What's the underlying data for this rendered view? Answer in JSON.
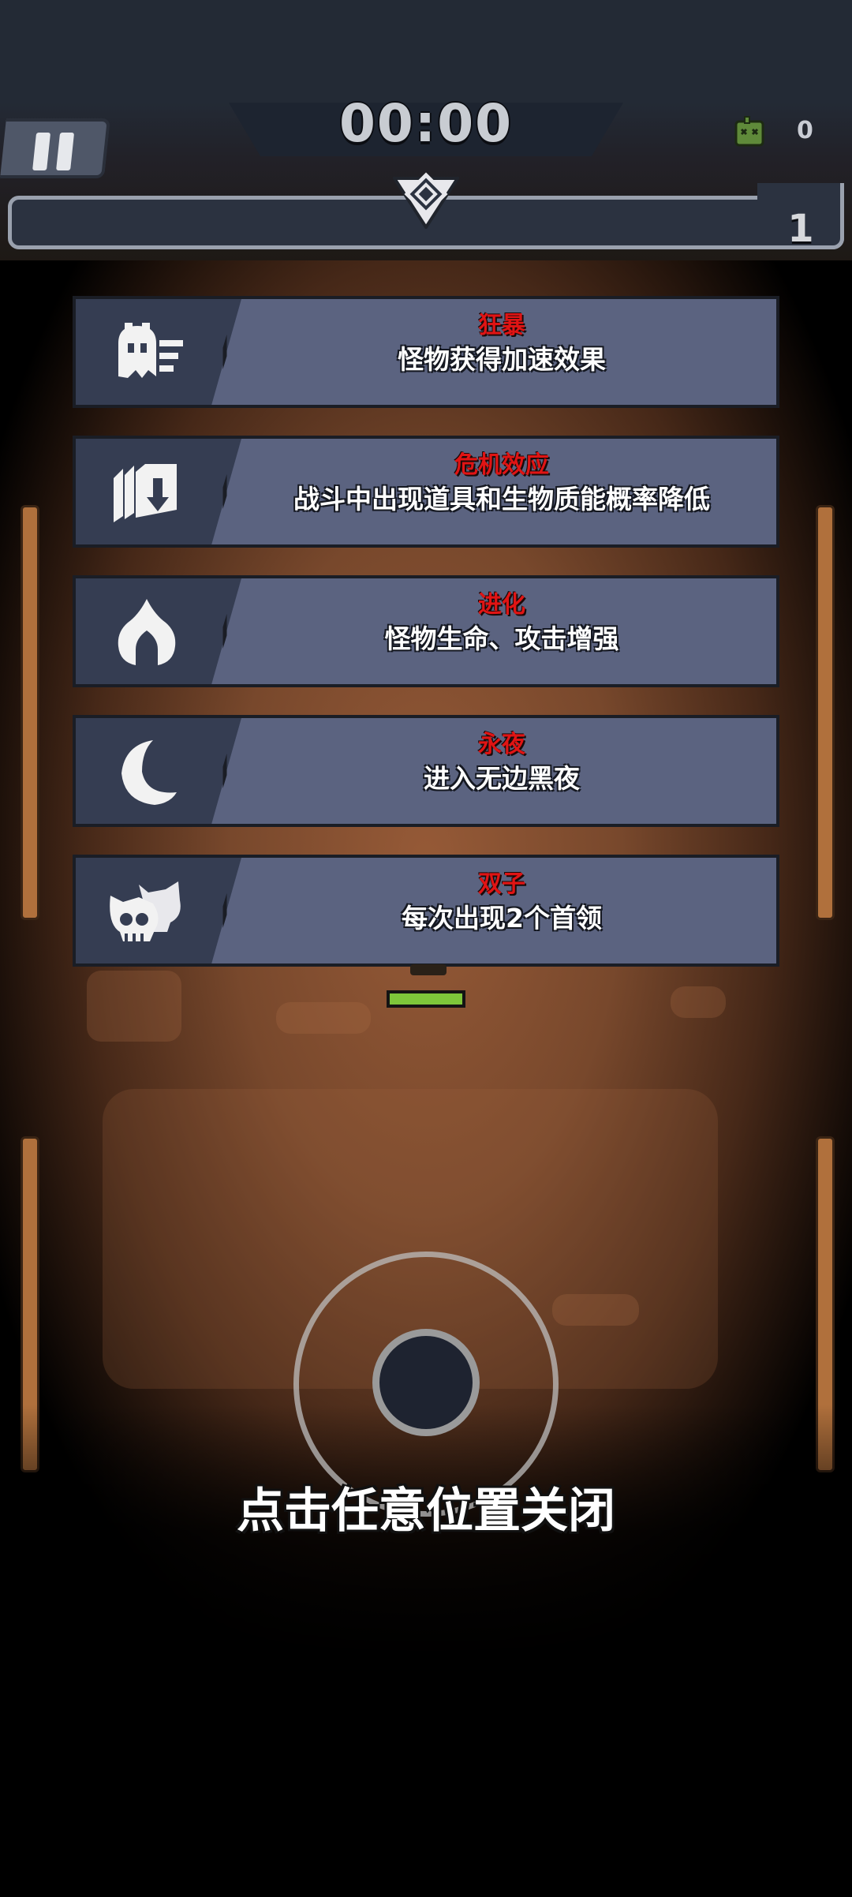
{
  "hud": {
    "timer": "00:00",
    "kill_count": "0",
    "level": "1",
    "icons": {
      "pause": "pause-icon",
      "kills": "zombie-head-icon",
      "tier": "diamond-rank-icon"
    }
  },
  "modifiers": [
    {
      "title": "狂暴",
      "description": "怪物获得加速效果",
      "icon": "speed-ghost-icon"
    },
    {
      "title": "危机效应",
      "description": "战斗中出现道具和生物质能概率降低",
      "icon": "crates-down-icon"
    },
    {
      "title": "进化",
      "description": "怪物生命、攻击增强",
      "icon": "flame-up-arrow-icon"
    },
    {
      "title": "永夜",
      "description": "进入无边黑夜",
      "icon": "crescent-moon-icon"
    },
    {
      "title": "双子",
      "description": "每次出现2个首领",
      "icon": "twin-skulls-icon"
    }
  ],
  "close_hint": "点击任意位置关闭",
  "colors": {
    "title_red": "#e01414",
    "card_body": "#5b6380",
    "card_icon_panel": "#353d52",
    "hp_green": "#7ec63a"
  },
  "player": {
    "hp_fraction": 1.0
  }
}
